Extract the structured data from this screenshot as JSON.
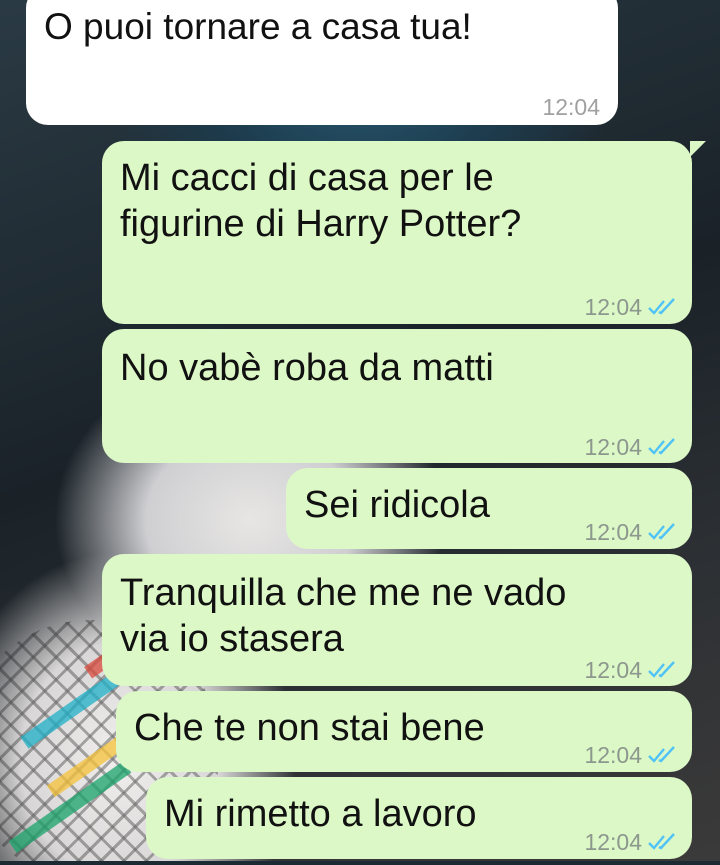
{
  "messages": [
    {
      "text": "O puoi tornare a casa tua!",
      "time": "12:04",
      "type": "received"
    },
    {
      "text": "Mi cacci di casa per le figurine di Harry Potter?",
      "time": "12:04",
      "type": "sent",
      "status": "read"
    },
    {
      "text": "No vabè roba da matti",
      "time": "12:04",
      "type": "sent",
      "status": "read"
    },
    {
      "text": "Sei ridicola",
      "time": "12:04",
      "type": "sent",
      "status": "read"
    },
    {
      "text": "Tranquilla che me ne vado via io stasera",
      "time": "12:04",
      "type": "sent",
      "status": "read"
    },
    {
      "text": "Che te non stai bene",
      "time": "12:04",
      "type": "sent",
      "status": "read"
    },
    {
      "text": "Mi rimetto a lavoro",
      "time": "12:04",
      "type": "sent",
      "status": "read"
    }
  ],
  "colors": {
    "received_bubble": "#ffffff",
    "sent_bubble": "#dcf8c6",
    "read_ticks": "#4fc3f7",
    "timestamp": "#8c978e"
  },
  "icons": {
    "read_receipt": "double-check-icon"
  }
}
